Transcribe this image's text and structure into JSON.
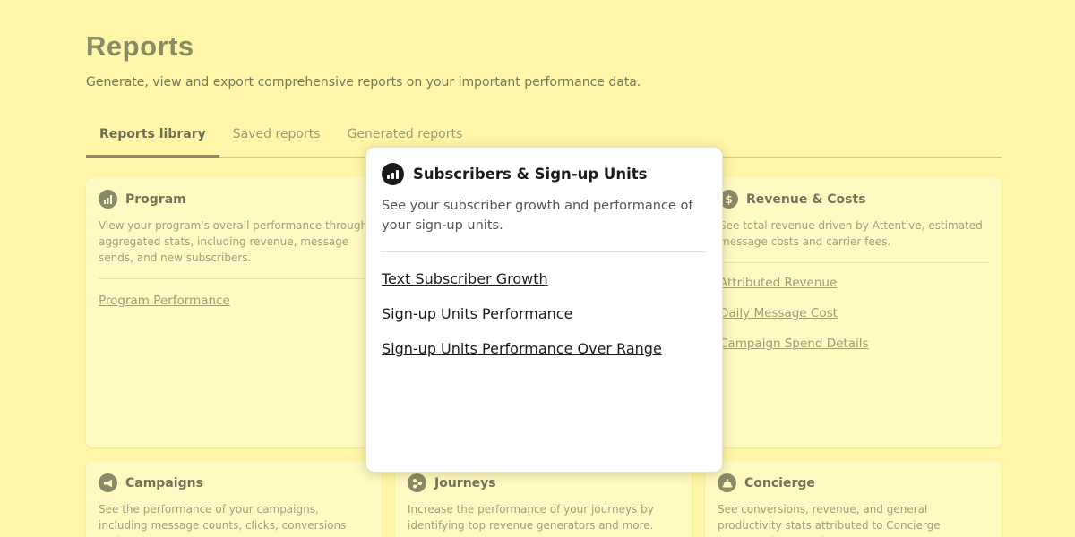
{
  "page": {
    "title": "Reports",
    "subtitle": "Generate, view and export comprehensive reports on your important performance data."
  },
  "tabs": [
    {
      "label": "Reports library",
      "active": true
    },
    {
      "label": "Saved reports",
      "active": false
    },
    {
      "label": "Generated reports",
      "active": false
    }
  ],
  "cards": {
    "program": {
      "icon": "bar-chart-icon",
      "title": "Program",
      "description": "View your program's overall performance through aggregated stats, including revenue, message sends, and new subscribers.",
      "links": [
        "Program Performance"
      ]
    },
    "revenue": {
      "icon": "dollar-icon",
      "title": "Revenue & Costs",
      "description": "See total revenue driven by Attentive, estimated message costs and carrier fees.",
      "links": [
        "Attributed Revenue",
        "Daily Message Cost",
        "Campaign Spend Details"
      ]
    },
    "campaigns": {
      "icon": "megaphone-icon",
      "title": "Campaigns",
      "description": "See the performance of your campaigns, including message counts, clicks, conversions and revenue."
    },
    "journeys": {
      "icon": "journey-icon",
      "title": "Journeys",
      "description": "Increase the performance of your journeys by identifying top revenue generators and more."
    },
    "concierge": {
      "icon": "bell-icon",
      "title": "Concierge",
      "description": "See conversions, revenue, and general productivity stats attributed to Concierge conversations starting"
    }
  },
  "popover": {
    "icon": "bar-chart-icon",
    "title": "Subscribers & Sign-up Units",
    "description": "See your subscriber growth and performance of your sign-up units.",
    "links": [
      "Text Subscriber Growth",
      "Sign-up Units Performance",
      "Sign-up Units Performance Over Range"
    ]
  },
  "colors": {
    "background": "#fff6a9",
    "card": "#fff9c2",
    "accent": "#8b8a68",
    "popover": "#ffffff"
  }
}
